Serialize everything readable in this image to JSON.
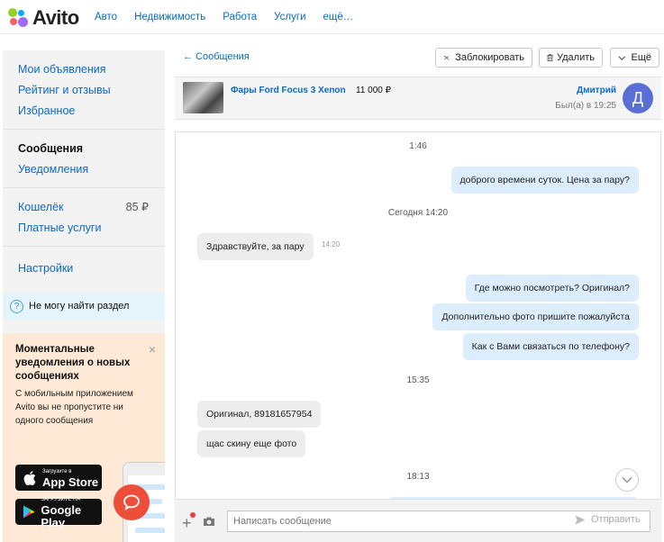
{
  "brand": {
    "logo_text": "Avito",
    "dot_colors": [
      "#97cf26",
      "#0af",
      "#ff6163",
      "#a169f7"
    ]
  },
  "topnav": {
    "links": [
      "Авто",
      "Недвижимость",
      "Работа",
      "Услуги",
      "ещё…"
    ]
  },
  "sidebar": {
    "group1": [
      "Мои объявления",
      "Рейтинг и отзывы",
      "Избранное"
    ],
    "group2": [
      "Сообщения",
      "Уведомления"
    ],
    "wallet_label": "Кошелёк",
    "wallet_value": "85 ₽",
    "paid_services": "Платные услуги",
    "settings": "Настройки",
    "help": "Не могу найти раздел"
  },
  "promo": {
    "title": "Моментальные уведомления о новых сообщениях",
    "body": "С мобильным приложением Avito вы не пропустите ни одного сообщения",
    "appstore_small": "Загрузите в",
    "appstore_big": "App Store",
    "gplay_small": "ЗАГРУЗИТЕ НА",
    "gplay_big": "Google Play"
  },
  "toolbar": {
    "back": "← Сообщения",
    "block": "Заблокировать",
    "delete": "Удалить",
    "more": "Ещё"
  },
  "item": {
    "title": "Фары Ford Focus 3 Xenon",
    "price": "11 000 ₽"
  },
  "user": {
    "name": "Дмитрий",
    "last_seen": "Был(а) в 19:25",
    "initial": "Д"
  },
  "chat": {
    "t1": "1:46",
    "m1": "доброго времени суток. Цена за пару?",
    "t2": "Сегодня 14:20",
    "m2": "Здравствуйте, за пару",
    "m2_time": "14:20",
    "m3": "Где можно посмотреть? Оригинал?",
    "m4": "Дополнительно фото пришите пожалуйста",
    "m5": "Как с Вами связаться по телефону?",
    "t3": "15:35",
    "m6": "Оригинал, 89181657954",
    "m7": "щас скину еще фото",
    "t4": "18:13"
  },
  "composer": {
    "placeholder": "Написать сообщение",
    "send": "Отправить"
  },
  "colors": {
    "link": "#0a69c7",
    "outgoing": "#dceefd",
    "incoming": "#ededed",
    "avatar": "#5a6fd6"
  }
}
